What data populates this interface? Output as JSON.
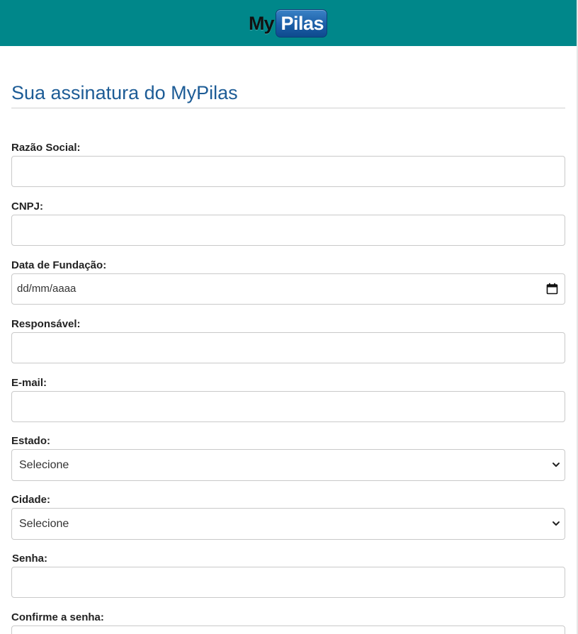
{
  "header": {
    "logo_my": "My",
    "logo_pilas": "Pilas",
    "background": "#00878a"
  },
  "page": {
    "title": "Sua assinatura do MyPilas",
    "title_color": "#1d5c96"
  },
  "form": {
    "razao_social": {
      "label": "Razão Social:",
      "value": ""
    },
    "cnpj": {
      "label": "CNPJ:",
      "value": ""
    },
    "data_fundacao": {
      "label": "Data de Fundação:",
      "placeholder": "dd/mm/aaaa",
      "icon": "calendar-icon"
    },
    "responsavel": {
      "label": "Responsável:",
      "value": ""
    },
    "email": {
      "label": "E-mail:",
      "value": ""
    },
    "estado": {
      "label": "Estado:",
      "selected": "Selecione",
      "icon": "chevron-down-icon"
    },
    "cidade": {
      "label": "Cidade:",
      "selected": "Selecione",
      "icon": "chevron-down-icon"
    },
    "senha": {
      "label": "Senha:",
      "value": ""
    },
    "confirme_senha": {
      "label": "Confirme a senha:",
      "value": ""
    }
  }
}
